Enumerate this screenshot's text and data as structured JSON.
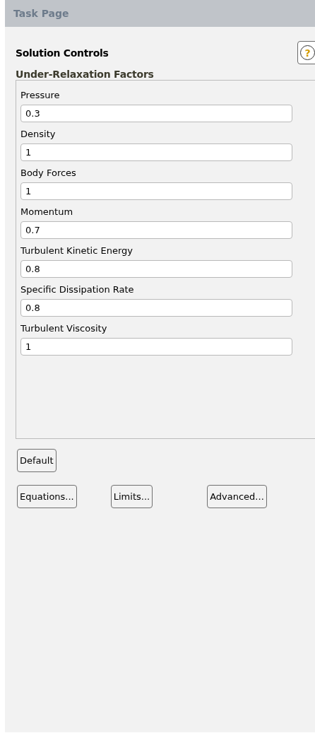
{
  "header": {
    "title": "Task Page"
  },
  "panel": {
    "title": "Solution Controls",
    "help_label": "?"
  },
  "group": {
    "title": "Under-Relaxation Factors",
    "fields": [
      {
        "label": "Pressure",
        "value": "0.3"
      },
      {
        "label": "Density",
        "value": "1"
      },
      {
        "label": "Body Forces",
        "value": "1"
      },
      {
        "label": "Momentum",
        "value": "0.7"
      },
      {
        "label": "Turbulent Kinetic Energy",
        "value": "0.8"
      },
      {
        "label": "Specific Dissipation Rate",
        "value": "0.8"
      },
      {
        "label": "Turbulent Viscosity",
        "value": "1"
      }
    ]
  },
  "default_button": {
    "label": "Default"
  },
  "buttons": [
    {
      "label": "Equations..."
    },
    {
      "label": "Limits..."
    },
    {
      "label": "Advanced..."
    }
  ]
}
